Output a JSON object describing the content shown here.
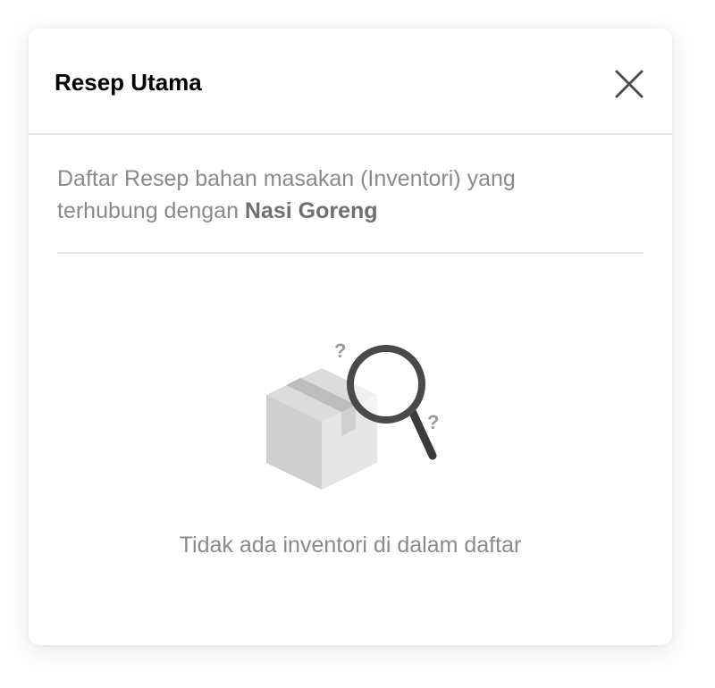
{
  "modal": {
    "title": "Resep Utama",
    "close_icon": "close-icon",
    "description_prefix": "Daftar Resep bahan masakan (Inventori) yang terhubung dengan ",
    "description_item": "Nasi Goreng",
    "empty_state": {
      "illustration_icons": [
        "box-icon",
        "magnifying-glass-icon",
        "question-mark-icon"
      ],
      "message": "Tidak ada inventori di dalam daftar"
    }
  },
  "colors": {
    "title": "#000000",
    "body_text": "#8a8a8a",
    "divider": "#e6e6e6",
    "box": "#d3d3d3",
    "magnifier": "#4a4a4a"
  }
}
